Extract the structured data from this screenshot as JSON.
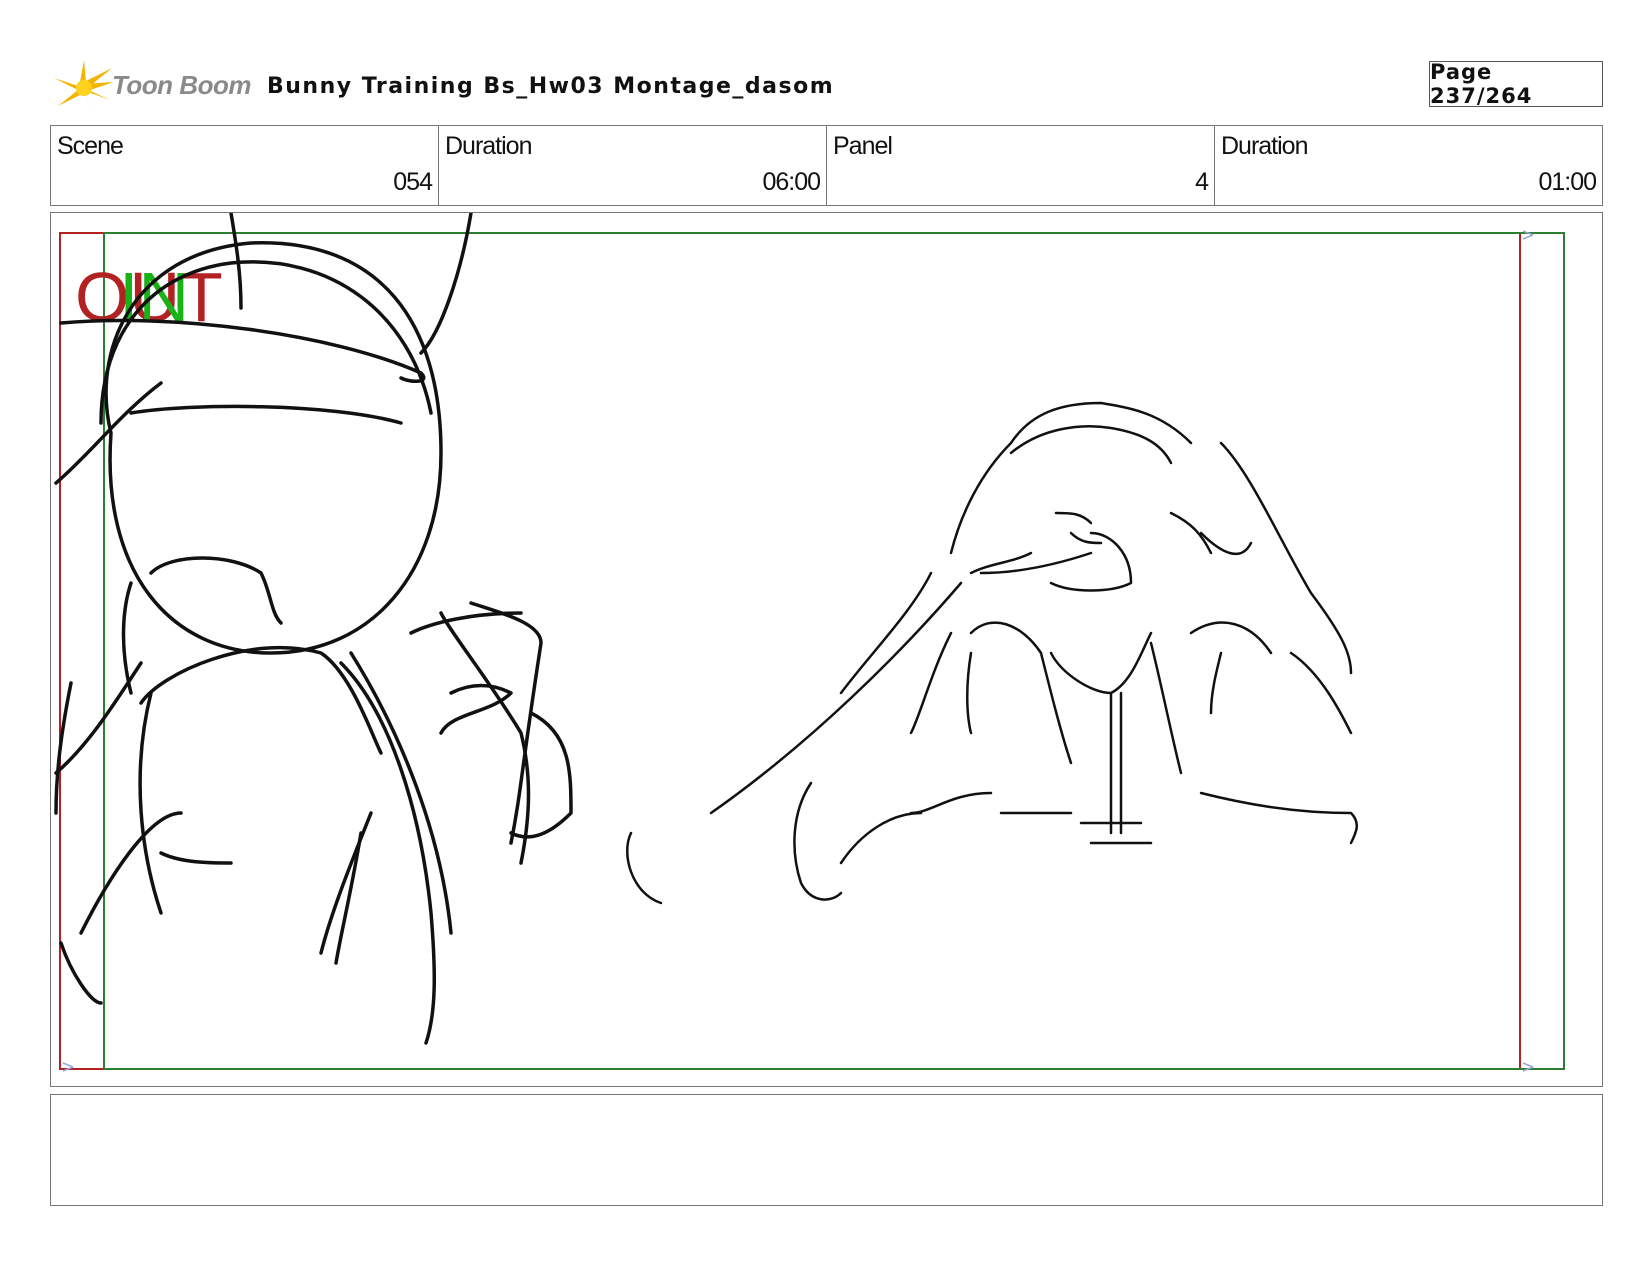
{
  "header": {
    "logo_text": "Toon Boom",
    "project_title": "Bunny Training  Bs_Hw03 Montage_dasom",
    "page_label": "Page 237/264"
  },
  "info": [
    {
      "label": "Scene",
      "value": "054"
    },
    {
      "label": "Duration",
      "value": "06:00"
    },
    {
      "label": "Panel",
      "value": "4"
    },
    {
      "label": "Duration",
      "value": "01:00"
    }
  ],
  "panel": {
    "out_label": "OUT",
    "in_label": "IN",
    "colors": {
      "out_frame": "#b22222",
      "in_frame": "#2e7d32",
      "sketch": "#111111"
    }
  },
  "notes": {
    "text": ""
  }
}
